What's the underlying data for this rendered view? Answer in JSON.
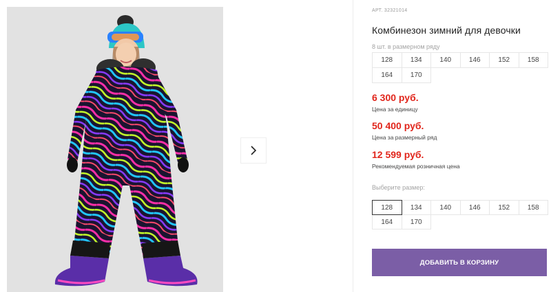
{
  "product": {
    "sku": "АРТ. 32321014",
    "title": "Комбинезон зимний для девочки",
    "pack_note": "8 шт. в размерном ряду"
  },
  "pack_sizes": [
    "128",
    "134",
    "140",
    "146",
    "152",
    "158",
    "164",
    "170"
  ],
  "prices": [
    {
      "value": "6 300 руб.",
      "label": "Цена за единицу"
    },
    {
      "value": "50 400 руб.",
      "label": "Цена за размерный ряд"
    },
    {
      "value": "12 599 руб.",
      "label": "Рекомендуемая розничная цена"
    }
  ],
  "size_picker": {
    "label": "Выберите размер:",
    "sizes": [
      "128",
      "134",
      "140",
      "146",
      "152",
      "158",
      "164",
      "170"
    ],
    "selected": "128"
  },
  "actions": {
    "add_to_cart": "ДОБАВИТЬ В КОРЗИНУ"
  },
  "colors": {
    "accent": "#7b5ea6",
    "price": "#e1261c"
  },
  "icons": {
    "next": "chevron-right-icon"
  }
}
